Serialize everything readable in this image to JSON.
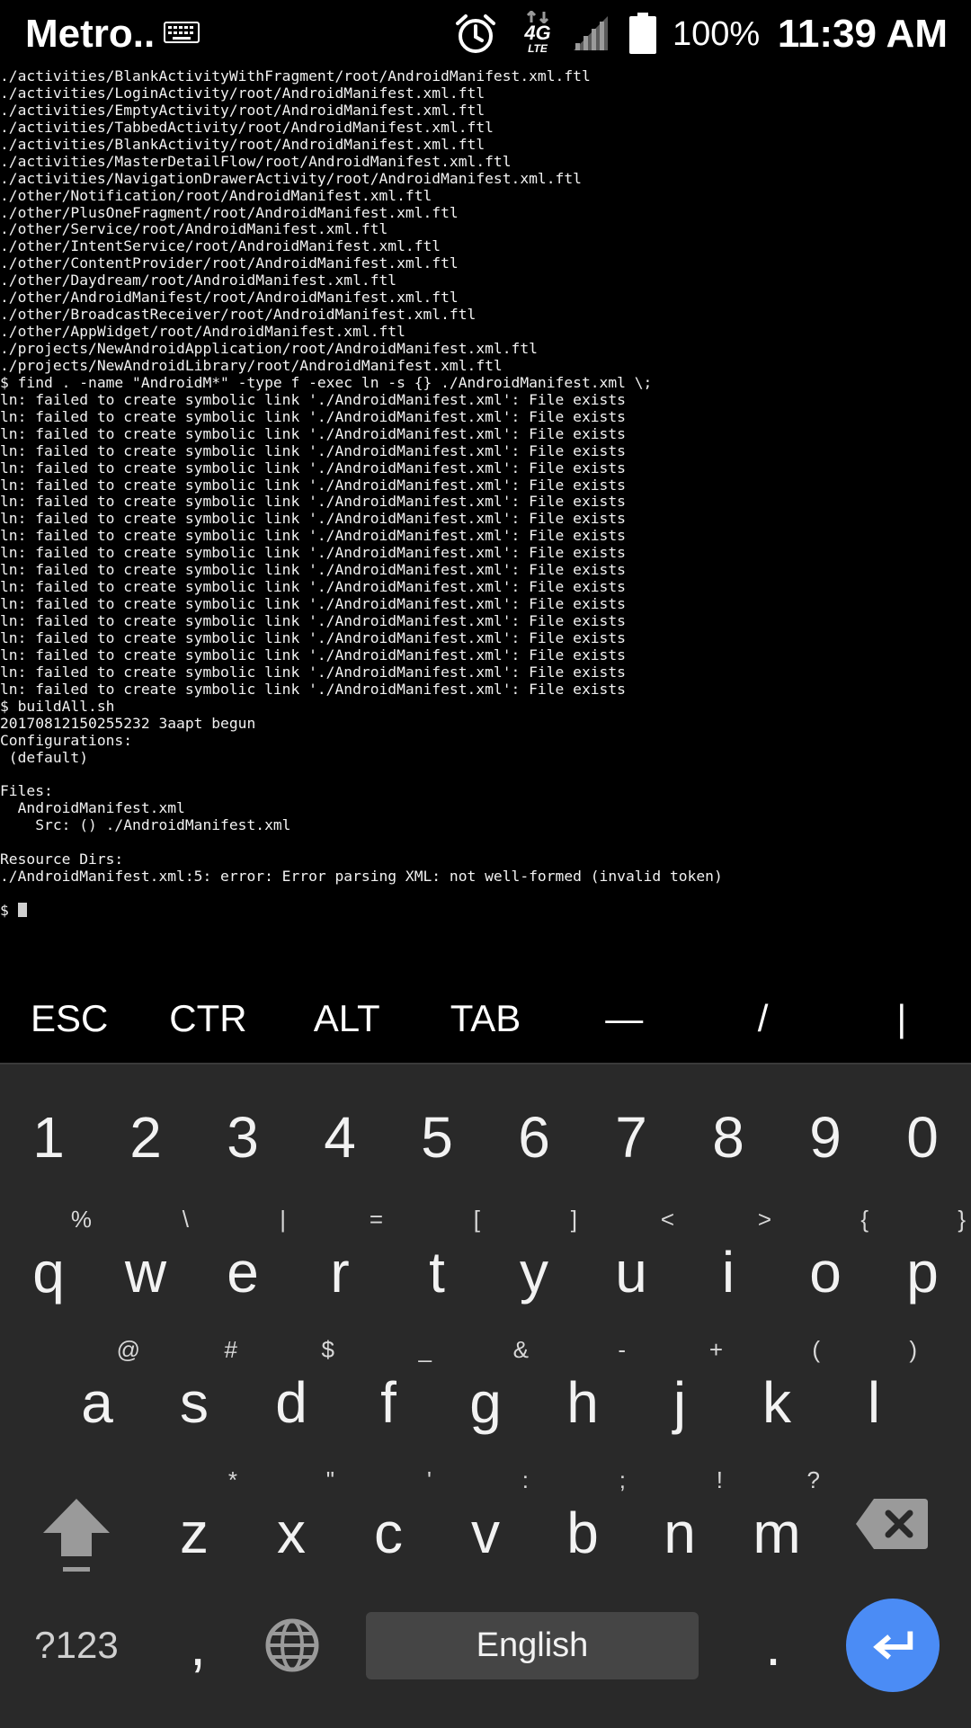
{
  "status_bar": {
    "carrier": "Metro..",
    "battery": "100%",
    "time": "11:39 AM",
    "network": "4G",
    "network_sub": "LTE",
    "icons": [
      "keyboard-icon",
      "alarm-icon",
      "network-4g-lte-icon",
      "signal-icon",
      "battery-icon"
    ]
  },
  "terminal": {
    "lines": [
      "./activities/BlankActivityWithFragment/root/AndroidManifest.xml.ftl",
      "./activities/LoginActivity/root/AndroidManifest.xml.ftl",
      "./activities/EmptyActivity/root/AndroidManifest.xml.ftl",
      "./activities/TabbedActivity/root/AndroidManifest.xml.ftl",
      "./activities/BlankActivity/root/AndroidManifest.xml.ftl",
      "./activities/MasterDetailFlow/root/AndroidManifest.xml.ftl",
      "./activities/NavigationDrawerActivity/root/AndroidManifest.xml.ftl",
      "./other/Notification/root/AndroidManifest.xml.ftl",
      "./other/PlusOneFragment/root/AndroidManifest.xml.ftl",
      "./other/Service/root/AndroidManifest.xml.ftl",
      "./other/IntentService/root/AndroidManifest.xml.ftl",
      "./other/ContentProvider/root/AndroidManifest.xml.ftl",
      "./other/Daydream/root/AndroidManifest.xml.ftl",
      "./other/AndroidManifest/root/AndroidManifest.xml.ftl",
      "./other/BroadcastReceiver/root/AndroidManifest.xml.ftl",
      "./other/AppWidget/root/AndroidManifest.xml.ftl",
      "./projects/NewAndroidApplication/root/AndroidManifest.xml.ftl",
      "./projects/NewAndroidLibrary/root/AndroidManifest.xml.ftl",
      "$ find . -name \"AndroidM*\" -type f -exec ln -s {} ./AndroidManifest.xml \\;",
      "ln: failed to create symbolic link './AndroidManifest.xml': File exists",
      "ln: failed to create symbolic link './AndroidManifest.xml': File exists",
      "ln: failed to create symbolic link './AndroidManifest.xml': File exists",
      "ln: failed to create symbolic link './AndroidManifest.xml': File exists",
      "ln: failed to create symbolic link './AndroidManifest.xml': File exists",
      "ln: failed to create symbolic link './AndroidManifest.xml': File exists",
      "ln: failed to create symbolic link './AndroidManifest.xml': File exists",
      "ln: failed to create symbolic link './AndroidManifest.xml': File exists",
      "ln: failed to create symbolic link './AndroidManifest.xml': File exists",
      "ln: failed to create symbolic link './AndroidManifest.xml': File exists",
      "ln: failed to create symbolic link './AndroidManifest.xml': File exists",
      "ln: failed to create symbolic link './AndroidManifest.xml': File exists",
      "ln: failed to create symbolic link './AndroidManifest.xml': File exists",
      "ln: failed to create symbolic link './AndroidManifest.xml': File exists",
      "ln: failed to create symbolic link './AndroidManifest.xml': File exists",
      "ln: failed to create symbolic link './AndroidManifest.xml': File exists",
      "ln: failed to create symbolic link './AndroidManifest.xml': File exists",
      "ln: failed to create symbolic link './AndroidManifest.xml': File exists",
      "$ buildAll.sh",
      "20170812150255232 3aapt begun",
      "Configurations:",
      " (default)",
      "",
      "Files:",
      "  AndroidManifest.xml",
      "    Src: () ./AndroidManifest.xml",
      "",
      "Resource Dirs:",
      "./AndroidManifest.xml:5: error: Error parsing XML: not well-formed (invalid token)",
      ""
    ],
    "prompt": "$ "
  },
  "extra_keys": [
    "ESC",
    "CTR",
    "ALT",
    "TAB",
    "—",
    "/",
    "|"
  ],
  "keyboard": {
    "numbers": [
      "1",
      "2",
      "3",
      "4",
      "5",
      "6",
      "7",
      "8",
      "9",
      "0"
    ],
    "row1": [
      "q",
      "w",
      "e",
      "r",
      "t",
      "y",
      "u",
      "i",
      "o",
      "p"
    ],
    "row1_hints": [
      "%",
      "\\",
      "|",
      "=",
      "[",
      "]",
      "<",
      ">",
      "{",
      "}"
    ],
    "row2": [
      "a",
      "s",
      "d",
      "f",
      "g",
      "h",
      "j",
      "k",
      "l"
    ],
    "row2_hints": [
      "@",
      "#",
      "$",
      "_",
      "&",
      "-",
      "+",
      "(",
      ")"
    ],
    "row3": [
      "z",
      "x",
      "c",
      "v",
      "b",
      "n",
      "m"
    ],
    "row3_hints": [
      "*",
      "\"",
      "'",
      ":",
      ";",
      "!",
      "?"
    ],
    "symbols_label": "?123",
    "comma_label": ",",
    "space_label": "English",
    "period_label": ".",
    "icons": [
      "shift-icon",
      "backspace-icon",
      "globe-icon",
      "enter-icon"
    ],
    "colors": {
      "background": "#292929",
      "space": "#454545",
      "enter": "#4b8cf5"
    }
  }
}
